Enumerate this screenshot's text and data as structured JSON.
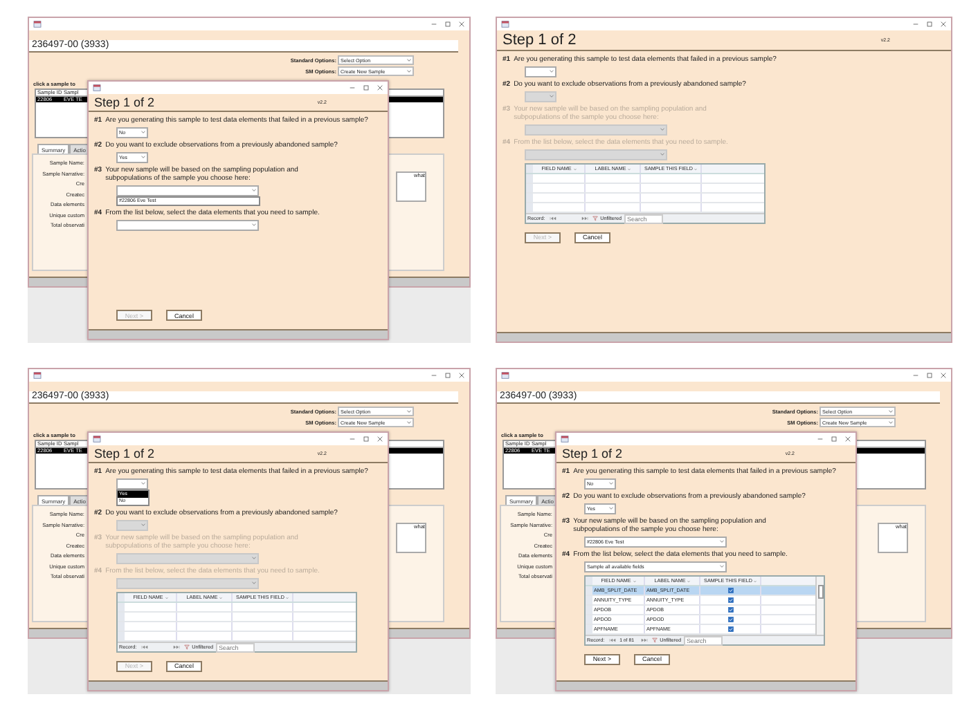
{
  "rows": [
    {
      "panels": [
        {
          "main": {
            "record_title": "236497-00 (3933)",
            "options": [
              {
                "label": "Standard Options:",
                "value": "Select Option"
              },
              {
                "label": "SM Options:",
                "value": "Create New Sample"
              }
            ],
            "list_caption": "click a sample to",
            "list_columns": [
              "Sample ID",
              "Sampl"
            ],
            "list_row": [
              "22806",
              "EVE TE"
            ],
            "tabs": [
              {
                "label": "Summary",
                "selected": true
              },
              {
                "label": "Actio",
                "selected": false
              }
            ],
            "field_labels": [
              "Sample Name:",
              "Sample Narrative:",
              "Cre",
              "Createc",
              "Data elements",
              "Unique custom",
              "Total observati"
            ],
            "side_text": "what"
          },
          "dialog": {
            "title": "Step 1 of 2",
            "version": "v2.2",
            "questions": [
              {
                "number": "#1",
                "text": "Are you generating this sample to test data elements that failed in a previous sample?",
                "disabled": false,
                "control": {
                  "kind": "select",
                  "value": "No",
                  "disabled": false
                }
              },
              {
                "number": "#2",
                "text": "Do you want to exclude observations from a previously abandoned sample?",
                "disabled": false,
                "control": {
                  "kind": "select",
                  "value": "Yes",
                  "disabled": false
                }
              },
              {
                "number": "#3",
                "text": "Your new sample will be based on the sampling population and\nsubpopulations of the sample you choose here:",
                "disabled": false,
                "control": {
                  "kind": "combo",
                  "disabled": false,
                  "list": [
                    {
                      "text": "#22806 Eve Test",
                      "selected": false
                    }
                  ]
                }
              },
              {
                "number": "#4",
                "text": "From the list below, select the data elements that you need to sample.",
                "disabled": false,
                "control": {
                  "kind": "combo",
                  "disabled": false
                }
              }
            ],
            "buttons": [
              {
                "label": "Next >",
                "disabled": true
              },
              {
                "label": "Cancel",
                "disabled": false
              }
            ]
          }
        },
        {
          "dialog": {
            "title": "Step 1 of 2",
            "version": "v2.2",
            "questions": [
              {
                "number": "#1",
                "text": "Are you generating this sample to test data elements that failed in a previous sample?",
                "disabled": false,
                "control": {
                  "kind": "select",
                  "disabled": false
                }
              },
              {
                "number": "#2",
                "text": "Do you want to exclude observations from a previously abandoned sample?",
                "disabled": false,
                "control": {
                  "kind": "select",
                  "disabled": true
                }
              },
              {
                "number": "#3",
                "text": "Your new sample will be based on the sampling population and\nsubpopulations of the sample you choose here:",
                "disabled": true,
                "control": {
                  "kind": "combo",
                  "disabled": true
                }
              },
              {
                "number": "#4",
                "text": "From the list below, select the data elements that you need to sample.",
                "disabled": true,
                "control": {
                  "kind": "combo",
                  "disabled": true
                }
              }
            ],
            "grid": {
              "columns": [
                "FIELD NAME",
                "LABEL NAME",
                "SAMPLE THIS FIELD"
              ],
              "nav": {
                "record": "Record:",
                "filter": "Unfiltered",
                "placeholder": "Search"
              }
            },
            "buttons": [
              {
                "label": "Next >",
                "disabled": true
              },
              {
                "label": "Cancel",
                "disabled": false
              }
            ]
          }
        }
      ]
    },
    {
      "panels": [
        {
          "main": {
            "record_title": "236497-00 (3933)",
            "options": [
              {
                "label": "Standard Options:",
                "value": "Select Option"
              },
              {
                "label": "SM Options:",
                "value": "Create New Sample"
              }
            ],
            "list_caption": "click a sample to",
            "list_columns": [
              "Sample ID",
              "Sampl"
            ],
            "list_row": [
              "22806",
              "EVE TE"
            ],
            "tabs": [
              {
                "label": "Summary",
                "selected": true
              },
              {
                "label": "Actio",
                "selected": false
              }
            ],
            "field_labels": [
              "Sample Name:",
              "Sample Narrative:",
              "Cre",
              "Createc",
              "Data elements",
              "Unique custom",
              "Total observati"
            ],
            "side_text": "what"
          },
          "dialog": {
            "title": "Step 1 of 2",
            "version": "v2.2",
            "questions": [
              {
                "number": "#1",
                "text": "Are you generating this sample to test data elements that failed in a previous sample?",
                "disabled": false,
                "control": {
                  "kind": "select",
                  "disabled": false,
                  "list": [
                    {
                      "text": "Yes",
                      "selected": true
                    },
                    {
                      "text": "No",
                      "selected": false
                    }
                  ]
                }
              },
              {
                "number": "#2",
                "text": "Do you want to exclude observations from a previously abandoned sample?",
                "disabled": false,
                "control": {
                  "kind": "select",
                  "disabled": true
                }
              },
              {
                "number": "#3",
                "text": "Your new sample will be based on the sampling population and\nsubpopulations of the sample you choose here:",
                "disabled": true,
                "control": {
                  "kind": "combo",
                  "disabled": true
                }
              },
              {
                "number": "#4",
                "text": "From the list below, select the data elements that you need to sample.",
                "disabled": true,
                "control": {
                  "kind": "combo",
                  "disabled": true
                }
              }
            ],
            "grid": {
              "columns": [
                "FIELD NAME",
                "LABEL NAME",
                "SAMPLE THIS FIELD"
              ],
              "nav": {
                "record": "Record:",
                "filter": "Unfiltered",
                "placeholder": "Search"
              }
            },
            "buttons": [
              {
                "label": "Next >",
                "disabled": true
              },
              {
                "label": "Cancel",
                "disabled": false
              }
            ]
          }
        },
        {
          "main": {
            "record_title": "236497-00 (3933)",
            "options": [
              {
                "label": "Standard Options:",
                "value": "Select Option"
              },
              {
                "label": "SM Options:",
                "value": "Create New Sample"
              }
            ],
            "list_caption": "click a sample to",
            "list_columns": [
              "Sample ID",
              "Sampl"
            ],
            "list_row": [
              "22806",
              "EVE TE"
            ],
            "tabs": [
              {
                "label": "Summary",
                "selected": true
              },
              {
                "label": "Actio",
                "selected": false
              }
            ],
            "field_labels": [
              "Sample Name:",
              "Sample Narrative:",
              "Cre",
              "Createc",
              "Data elements",
              "Unique custom",
              "Total observati"
            ],
            "side_text": "what"
          },
          "dialog": {
            "title": "Step 1 of 2",
            "version": "v2.2",
            "questions": [
              {
                "number": "#1",
                "text": "Are you generating this sample to test data elements that failed in a previous sample?",
                "disabled": false,
                "control": {
                  "kind": "select",
                  "value": "No",
                  "disabled": false
                }
              },
              {
                "number": "#2",
                "text": "Do you want to exclude observations from a previously abandoned sample?",
                "disabled": false,
                "control": {
                  "kind": "select",
                  "value": "Yes",
                  "disabled": false
                }
              },
              {
                "number": "#3",
                "text": "Your new sample will be based on the sampling population and\nsubpopulations of the sample you choose here:",
                "disabled": false,
                "control": {
                  "kind": "combo",
                  "value": "#22806 Eve Test",
                  "disabled": false
                }
              },
              {
                "number": "#4",
                "text": "From the list below, select the data elements that you need to sample.",
                "disabled": false,
                "control": {
                  "kind": "combo",
                  "value": "Sample all available fields",
                  "disabled": false
                }
              }
            ],
            "grid": {
              "columns": [
                "FIELD NAME",
                "LABEL NAME",
                "SAMPLE THIS FIELD"
              ],
              "rows": [
                {
                  "field": "AMB_SPLIT_DATE",
                  "label": "AMB_SPLIT_DATE",
                  "checked": true,
                  "selected": true
                },
                {
                  "field": "ANNUITY_TYPE",
                  "label": "ANNUITY_TYPE",
                  "checked": true,
                  "selected": false
                },
                {
                  "field": "APDOB",
                  "label": "APDOB",
                  "checked": true,
                  "selected": false
                },
                {
                  "field": "APDOD",
                  "label": "APDOD",
                  "checked": true,
                  "selected": false
                },
                {
                  "field": "APFNAME",
                  "label": "APFNAME",
                  "checked": true,
                  "selected": false
                }
              ],
              "nav": {
                "record": "Record:",
                "position": "1 of 81",
                "filter": "Unfiltered",
                "placeholder": "Search"
              }
            },
            "buttons": [
              {
                "label": "Next >",
                "disabled": false
              },
              {
                "label": "Cancel",
                "disabled": false
              }
            ]
          }
        }
      ]
    }
  ]
}
